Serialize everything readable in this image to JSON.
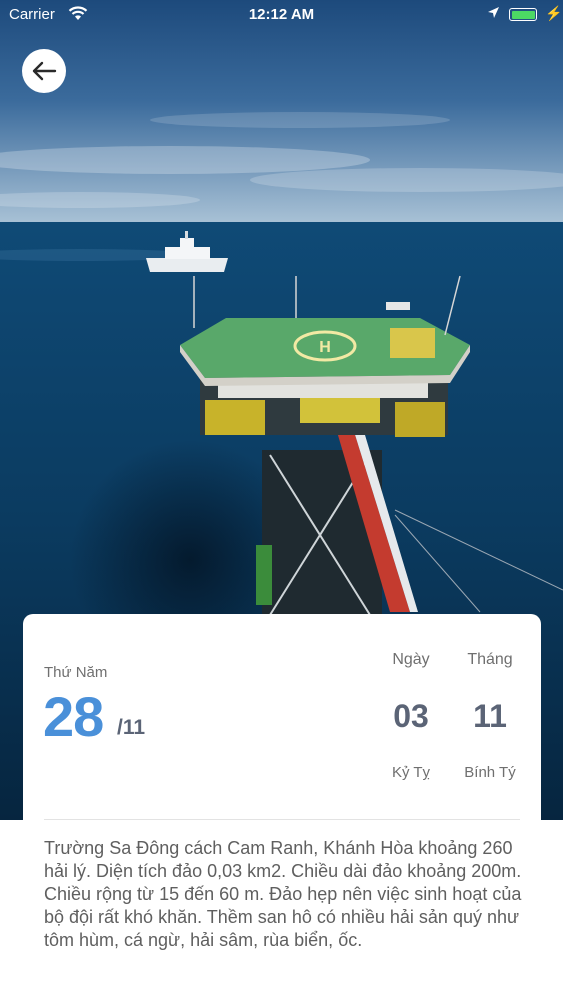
{
  "status_bar": {
    "carrier": "Carrier",
    "time": "12:12 AM",
    "battery_level": 1.0
  },
  "hero": {
    "icon": "offshore-platform-photo"
  },
  "back_button": {
    "icon": "arrow-left-icon"
  },
  "date_card": {
    "weekday": "Thứ Năm",
    "day": "28",
    "month": "/11",
    "lunar": {
      "day_header": "Ngày",
      "month_header": "Tháng",
      "day_value": "03",
      "month_value": "11",
      "day_name": "Kỷ Tỵ",
      "month_name": "Bính Tý"
    }
  },
  "description": "Trường Sa Đông cách Cam Ranh, Khánh Hòa khoảng 260 hải lý. Diện tích đảo 0,03 km2. Chiều dài đảo khoảng 200m. Chiều rộng từ 15 đến 60 m. Đảo hẹp nên việc sinh hoạt của bộ đội rất khó khăn. Thềm san hô có nhiều hải sản quý như tôm hùm, cá ngừ, hải sâm, rùa biển, ốc.",
  "colors": {
    "accent": "#4a90d9",
    "lunar_values": "#5b6476",
    "muted_text": "#6f6f6f",
    "sea": "#0d3f66",
    "sky": "#2f5f93"
  }
}
